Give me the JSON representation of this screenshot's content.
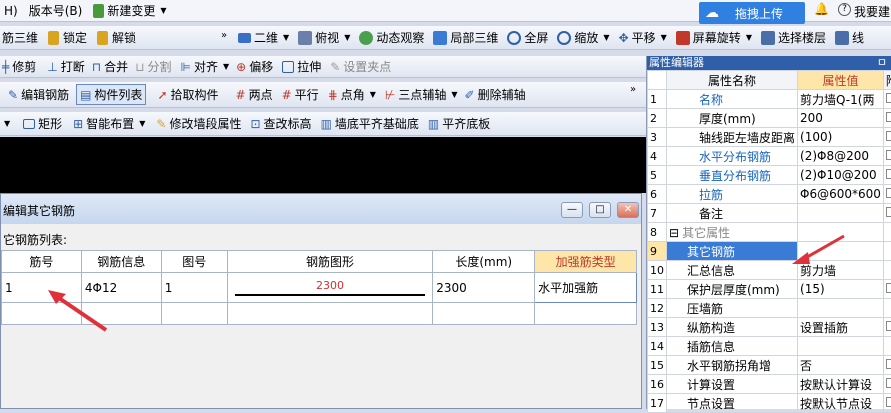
{
  "menubar": {
    "help": "H)",
    "help_prefix": "助(",
    "version": "版本号(B)",
    "new_change": "新建变更",
    "upload_button": "拖拽上传",
    "help_right": "我要建"
  },
  "toolbar1": {
    "items": [
      "筋三维",
      "锁定",
      "解锁",
      "二维",
      "俯视",
      "动态观察",
      "局部三维",
      "全屏",
      "缩放",
      "平移",
      "屏幕旋转",
      "选择楼层",
      "线"
    ]
  },
  "toolbar2": {
    "items": [
      "修剪",
      "打断",
      "合并",
      "分割",
      "对齐",
      "偏移",
      "拉伸",
      "设置夹点"
    ]
  },
  "toolbar3": {
    "items": [
      "编辑钢筋",
      "构件列表",
      "拾取构件",
      "两点",
      "平行",
      "点角",
      "三点辅轴",
      "删除辅轴"
    ]
  },
  "toolbar4": {
    "items": [
      "矩形",
      "智能布置",
      "修改墙段属性",
      "查改标高",
      "墙底平齐基础底",
      "平齐底板"
    ]
  },
  "dialog": {
    "title": "编辑其它钢筋",
    "list_label": "它钢筋列表:",
    "columns": [
      "筋号",
      "钢筋信息",
      "图号",
      "钢筋图形",
      "长度(mm)",
      "加强筋类型"
    ],
    "rows": [
      {
        "no": "1",
        "info": "4Φ12",
        "fig": "1",
        "shape": "2300",
        "length": "2300",
        "type": "水平加强筋"
      }
    ]
  },
  "property_editor": {
    "title": "属性编辑器",
    "pin": "ㅁ",
    "columns": [
      "属性名称",
      "属性值",
      "附"
    ],
    "rows": [
      {
        "n": "1",
        "name": "名称",
        "value": "剪力墙Q-1(两",
        "blue": true
      },
      {
        "n": "2",
        "name": "厚度(mm)",
        "value": "200",
        "blue": false
      },
      {
        "n": "3",
        "name": "轴线距左墙皮距离",
        "value": "(100)",
        "blue": false
      },
      {
        "n": "4",
        "name": "水平分布钢筋",
        "value": "(2)Φ8@200",
        "blue": true
      },
      {
        "n": "5",
        "name": "垂直分布钢筋",
        "value": "(2)Φ10@200",
        "blue": true
      },
      {
        "n": "6",
        "name": "拉筋",
        "value": "Φ6@600*600",
        "blue": true
      },
      {
        "n": "7",
        "name": "备注",
        "value": "",
        "blue": false
      },
      {
        "n": "8",
        "name": "其它属性",
        "value": "",
        "blue": false
      },
      {
        "n": "9",
        "name": "其它钢筋",
        "value": "",
        "blue": false
      },
      {
        "n": "10",
        "name": "汇总信息",
        "value": "剪力墙",
        "blue": false
      },
      {
        "n": "11",
        "name": "保护层厚度(mm)",
        "value": "(15)",
        "blue": false
      },
      {
        "n": "12",
        "name": "压墙筋",
        "value": "",
        "blue": false
      },
      {
        "n": "13",
        "name": "纵筋构造",
        "value": "设置插筋",
        "blue": false
      },
      {
        "n": "14",
        "name": "插筋信息",
        "value": "",
        "blue": false
      },
      {
        "n": "15",
        "name": "水平钢筋拐角增",
        "value": "否",
        "blue": false
      },
      {
        "n": "16",
        "name": "计算设置",
        "value": "按默认计算设",
        "blue": false
      },
      {
        "n": "17",
        "name": "节点设置",
        "value": "按默认节点设",
        "blue": false
      }
    ]
  },
  "colors": {
    "accent": "#2f5fa8",
    "highlight_header": "#fde6a8",
    "selected_row": "#3a7bd5",
    "arrow": "#e0303a",
    "shape_text": "#d32f2f"
  }
}
